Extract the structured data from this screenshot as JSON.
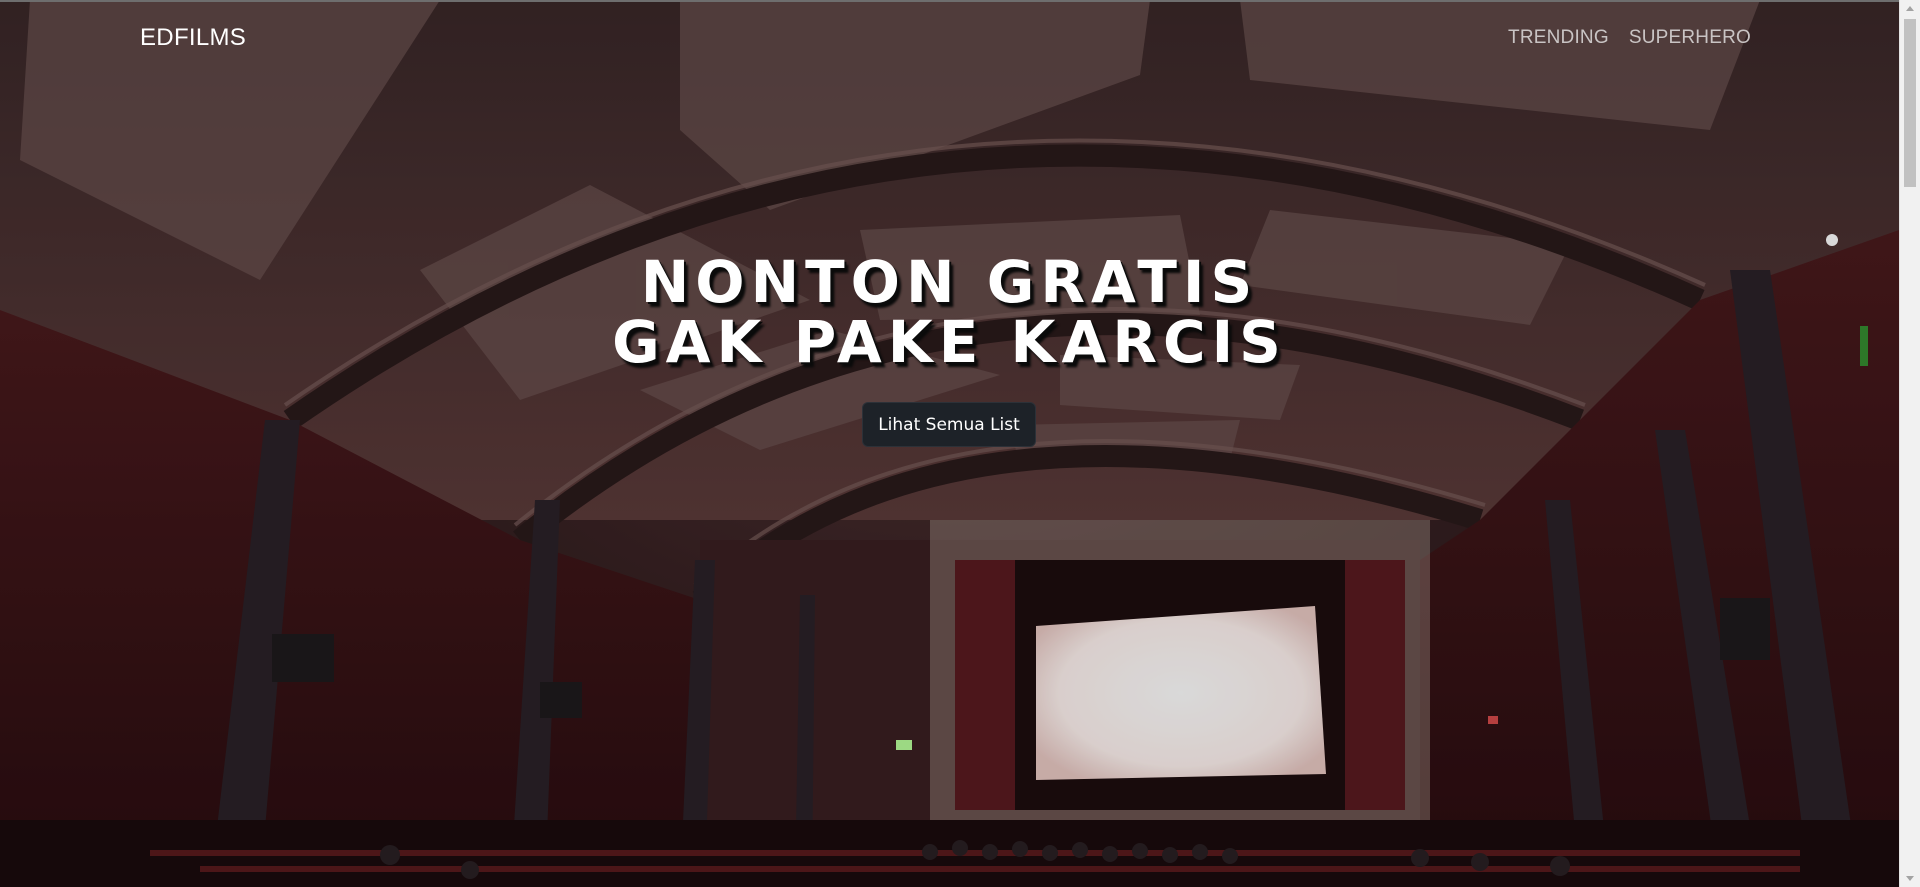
{
  "navbar": {
    "brand": "EDFILMS",
    "links": [
      {
        "label": "TRENDING"
      },
      {
        "label": "SUPERHERO"
      }
    ]
  },
  "hero": {
    "title_line1": "NONTON GRATIS",
    "title_line2": "GAK PAKE KARCIS",
    "cta_label": "Lihat Semua List",
    "background": "cinema auditorium photo"
  },
  "colors": {
    "button_bg": "#1d2228",
    "text": "#ffffff",
    "nav_link": "#c9c4c4"
  }
}
